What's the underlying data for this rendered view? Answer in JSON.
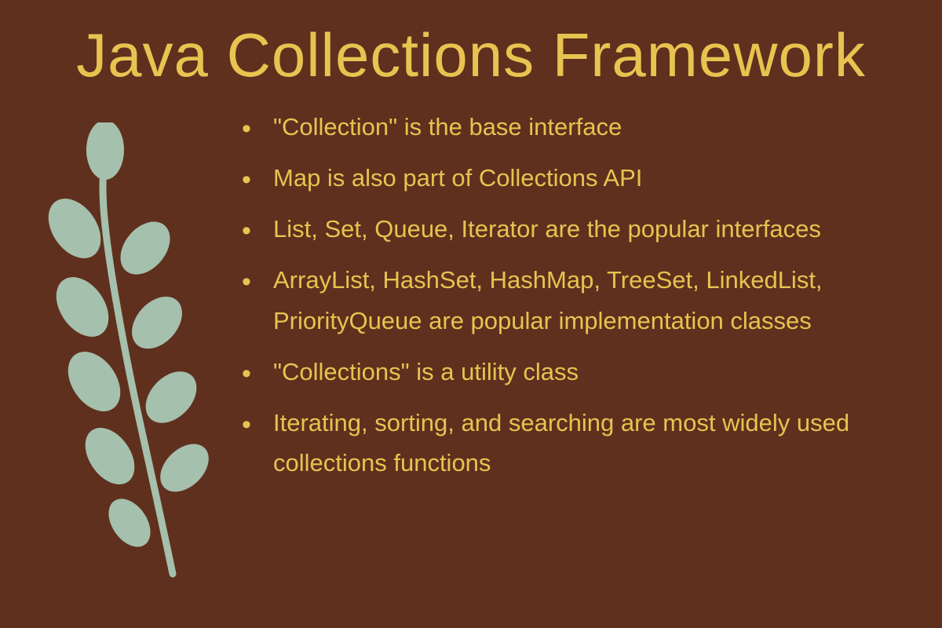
{
  "title": "Java Collections Framework",
  "bullets": [
    "\"Collection\" is the base interface",
    "Map is also part of Collections API",
    "List, Set, Queue, Iterator are the popular interfaces",
    "ArrayList, HashSet, HashMap, TreeSet, LinkedList, PriorityQueue are popular implementation classes",
    "\"Collections\" is a utility class",
    "Iterating, sorting, and searching are most widely used collections functions"
  ],
  "colors": {
    "background": "#5F301E",
    "text": "#E8C350",
    "leaf": "#A5C0AD"
  }
}
